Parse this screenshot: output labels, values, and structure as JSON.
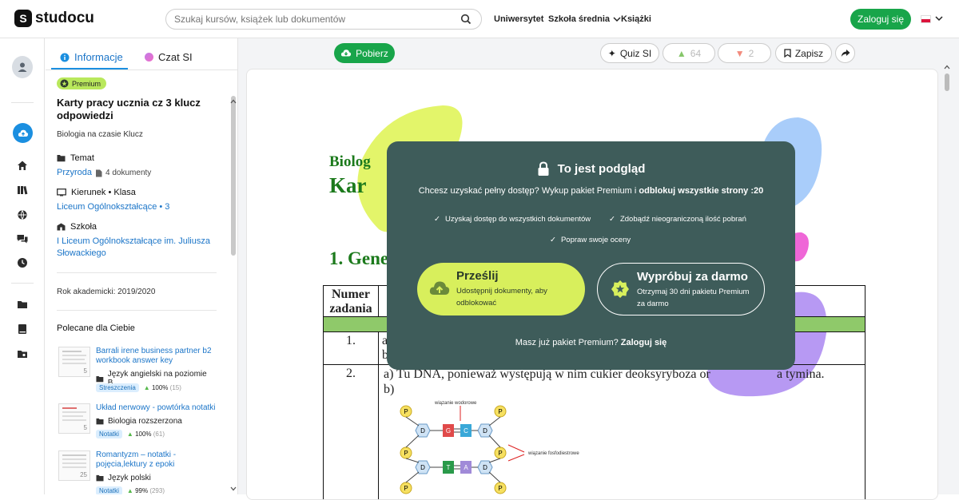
{
  "header": {
    "logo_text": "studocu",
    "search_placeholder": "Szukaj kursów, książek lub dokumentów",
    "nav": [
      "Uniwersytet",
      "Szkoła średnia",
      "Książki"
    ],
    "login_label": "Zaloguj się"
  },
  "tabs": {
    "info": "Informacje",
    "chat": "Czat SI"
  },
  "doc": {
    "badge": "Premium",
    "title": "Karty pracy ucznia cz 3 klucz odpowiedzi",
    "subtitle": "Biologia na czasie Klucz",
    "topic_label": "Temat",
    "topic_value": "Przyroda",
    "topic_count": "4 dokumenty",
    "track_label": "Kierunek • Klasa",
    "track_value": "Liceum Ogólnokształcące • 3",
    "school_label": "Szkoła",
    "school_value": "I Liceum Ogólnokształcące im. Juliusza Słowackiego",
    "year": "Rok akademicki: 2019/2020"
  },
  "recommended": {
    "heading": "Polecane dla Ciebie",
    "items": [
      {
        "title": "Barrali irene business partner b2 workbook answer key",
        "category": "Język angielski na poziomie B...",
        "tag": "Streszczenia",
        "rating": "100%",
        "count": "(15)",
        "pages": "5"
      },
      {
        "title": "Układ nerwowy - powtórka notatki",
        "category": "Biologia rozszerzona",
        "tag": "Notatki",
        "rating": "100%",
        "count": "(61)",
        "pages": "5"
      },
      {
        "title": "Romantyzm – notatki - pojęcia,lektury z epoki",
        "category": "Język polski",
        "tag": "Notatki",
        "rating": "99%",
        "count": "(293)",
        "pages": "25"
      }
    ]
  },
  "toolbar": {
    "download": "Pobierz",
    "quiz": "Quiz SI",
    "likes": "64",
    "dislikes": "2",
    "save": "Zapisz"
  },
  "document_preview": {
    "heading1": "Biolog",
    "heading2": "Kar",
    "section": "1. Gene",
    "col1_header_line1": "Numer",
    "col1_header_line2": "zadania",
    "row1_no": "1.",
    "row1_text_a": "a",
    "row1_text_b": "b",
    "row2_no": "2.",
    "row2_text": "a) Tu DNA, ponieważ występują w nim cukier deoksyryboza or",
    "row2_text_end": "a tymina.",
    "row2_b": "b)",
    "dna_label_top": "wiązanie wodorowe",
    "dna_label_right": "wiązanie fosfodiestrowe",
    "dna_P": "P",
    "dna_D": "D",
    "dna_G": "G",
    "dna_C": "C",
    "dna_T": "T",
    "dna_A": "A"
  },
  "modal": {
    "title": "To jest podgląd",
    "subtitle_plain": "Chcesz uzyskać pełny dostęp? Wykup pakiet Premium i ",
    "subtitle_bold": "odblokuj wszystkie strony :20",
    "feature1": "Uzyskaj dostęp do wszystkich dokumentów",
    "feature2": "Zdobądź nieograniczoną ilość pobrań",
    "feature3": "Popraw swoje oceny",
    "upload_title": "Prześlij",
    "upload_desc": "Udostępnij dokumenty, aby odblokować",
    "trial_title": "Wypróbuj za darmo",
    "trial_desc": "Otrzymaj 30 dni pakietu Premium za darmo",
    "footer_plain": "Masz już pakiet Premium? ",
    "footer_link": "Zaloguj się"
  },
  "colors": {
    "green": "#18a54a",
    "blue": "#1b8fe0",
    "modal_bg": "#3e5c5a",
    "lime": "#d8ef5c"
  }
}
